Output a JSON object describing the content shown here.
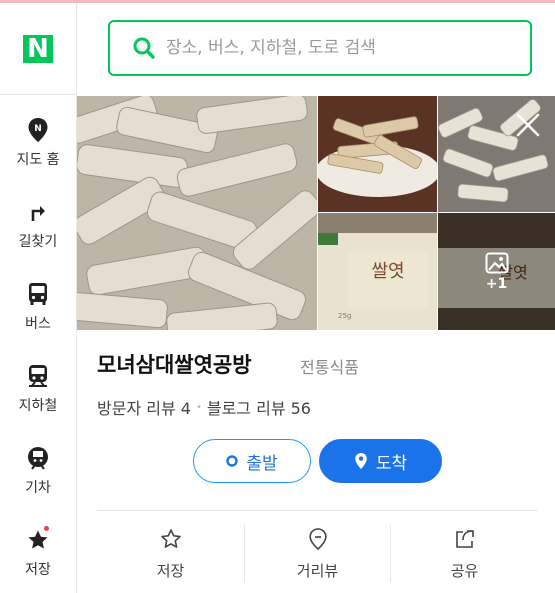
{
  "app": {
    "logo_letter": "N",
    "brand_color": "#03c75a"
  },
  "sidebar": {
    "items": [
      {
        "label": "지도 홈",
        "icon": "map-pin-icon"
      },
      {
        "label": "길찾기",
        "icon": "directions-icon"
      },
      {
        "label": "버스",
        "icon": "bus-icon"
      },
      {
        "label": "지하철",
        "icon": "subway-icon"
      },
      {
        "label": "기차",
        "icon": "train-icon"
      },
      {
        "label": "저장",
        "icon": "star-icon"
      }
    ]
  },
  "search": {
    "placeholder": "장소, 버스, 지하철, 도로 검색",
    "value": ""
  },
  "photos": {
    "more_count": "+1"
  },
  "place": {
    "name": "모녀삼대쌀엿공방",
    "category": "전통식품",
    "visitor_reviews": "방문자 리뷰 4",
    "separator": "•",
    "blog_reviews": "블로그 리뷰 56"
  },
  "buttons": {
    "start": "출발",
    "arrive": "도착"
  },
  "actions": {
    "save": "저장",
    "street_view": "거리뷰",
    "share": "공유"
  },
  "colors": {
    "accent_blue": "#1a73e8",
    "green": "#03c75a"
  }
}
